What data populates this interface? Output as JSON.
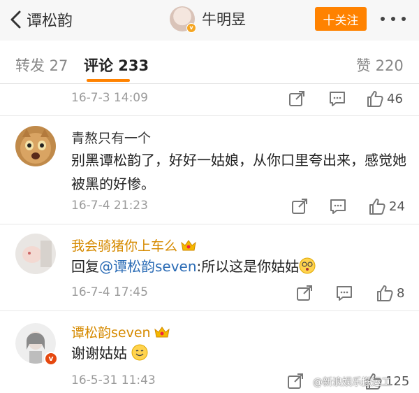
{
  "nav": {
    "back_label": "谭松韵",
    "profile_name": "牛明昱",
    "follow_label": "十关注"
  },
  "tabs": {
    "repost": "转发 27",
    "comments": "评论 233",
    "likes": "赞 220"
  },
  "comments": [
    {
      "time": "16-7-3 14:09",
      "likes": "46"
    },
    {
      "name": "青熬只有一个",
      "text": "别黑谭松韵了，好好一姑娘，从你口里夸出来，感觉她被黑的好惨。",
      "time": "16-7-4 21:23",
      "likes": "24"
    },
    {
      "name": "我会骑猪你上车么",
      "reply_prefix": "回复",
      "mention": "@谭松韵seven",
      "text_after": ":所以这是你姑姑",
      "time": "16-7-4 17:45",
      "likes": "8"
    },
    {
      "name": "谭松韵seven",
      "text": "谢谢姑姑",
      "time": "16-5-31 11:43",
      "likes": "125"
    }
  ],
  "watermark": "@新浪娱乐搬运工",
  "colors": {
    "accent": "#ff8200",
    "vip_name": "#d68a00",
    "mention": "#2a6bb5"
  }
}
